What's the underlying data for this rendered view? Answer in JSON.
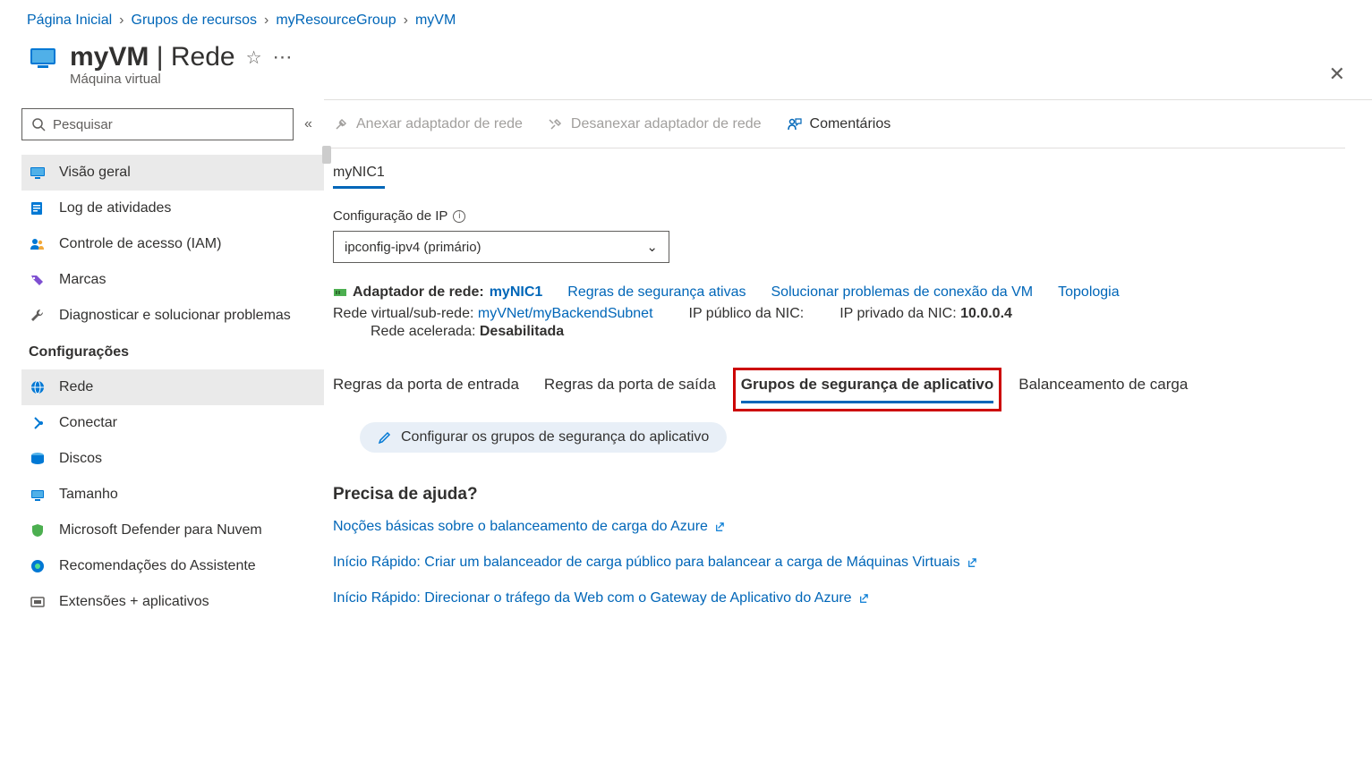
{
  "breadcrumb": {
    "home": "Página Inicial",
    "rg": "Grupos de recursos",
    "rgName": "myResourceGroup",
    "vm": "myVM"
  },
  "header": {
    "title_left": "myVM",
    "title_right": "Rede",
    "subtitle": "Máquina virtual"
  },
  "search": {
    "placeholder": "Pesquisar"
  },
  "sidebar": {
    "items": [
      {
        "label": "Visão geral"
      },
      {
        "label": "Log de atividades"
      },
      {
        "label": "Controle de acesso (IAM)"
      },
      {
        "label": "Marcas"
      },
      {
        "label": "Diagnosticar e solucionar problemas"
      }
    ],
    "section2_header": "Configurações",
    "items2": [
      {
        "label": "Rede"
      },
      {
        "label": "Conectar"
      },
      {
        "label": "Discos"
      },
      {
        "label": "Tamanho"
      },
      {
        "label": "Microsoft Defender para Nuvem"
      },
      {
        "label": "Recomendações do Assistente"
      },
      {
        "label": "Extensões + aplicativos"
      }
    ]
  },
  "toolbar": {
    "attach": "Anexar adaptador de rede",
    "detach": "Desanexar adaptador de rede",
    "feedback": "Comentários"
  },
  "nic": {
    "name": "myNIC1"
  },
  "ipconfig": {
    "label": "Configuração de IP",
    "selected": "ipconfig-ipv4 (primário)"
  },
  "adapter": {
    "label": "Adaptador de rede:",
    "name": "myNIC1",
    "rules_link": "Regras de segurança ativas",
    "troubleshoot_link": "Solucionar problemas de conexão da VM",
    "topology_link": "Topologia"
  },
  "details": {
    "vnet_label": "Rede virtual/sub-rede:",
    "vnet_value": "myVNet/myBackendSubnet",
    "pubip_label": "IP público da NIC:",
    "privip_label": "IP privado da NIC:",
    "privip_value": "10.0.0.4",
    "accel_label": "Rede acelerada:",
    "accel_value": "Desabilitada"
  },
  "tabs": [
    "Regras da porta de entrada",
    "Regras da porta de saída",
    "Grupos de segurança de aplicativo",
    "Balanceamento de carga"
  ],
  "config_asg": "Configurar os grupos de segurança do aplicativo",
  "help": {
    "title": "Precisa de ajuda?",
    "links": [
      "Noções básicas sobre o balanceamento de carga do Azure",
      "Início Rápido: Criar um balanceador de carga público para balancear a carga de Máquinas Virtuais",
      "Início Rápido: Direcionar o tráfego da Web com o Gateway de Aplicativo do Azure"
    ]
  }
}
